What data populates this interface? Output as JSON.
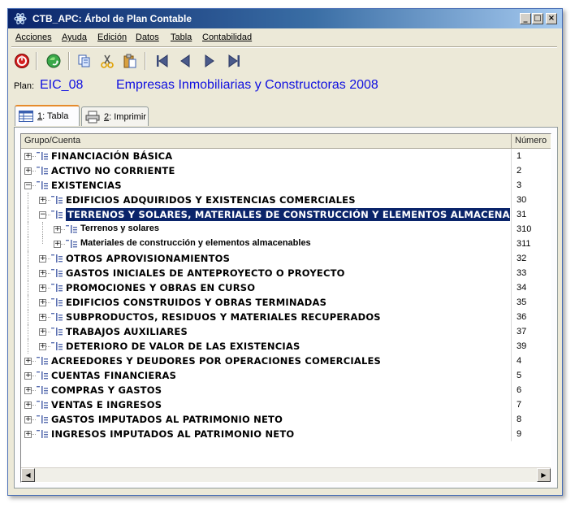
{
  "window": {
    "title": "CTB_APC: Árbol de Plan Contable"
  },
  "menu": [
    "Acciones",
    "Ayuda",
    "Edición",
    "Datos",
    "Tabla",
    "Contabilidad"
  ],
  "toolbar": {
    "icons": [
      "close-red-icon",
      "refresh-globe-icon",
      "copy-icon",
      "cut-icon",
      "paste-icon",
      "first-record-icon",
      "previous-record-icon",
      "next-record-icon",
      "last-record-icon"
    ]
  },
  "plan": {
    "label": "Plan:",
    "code": "EIC_08",
    "name": "Empresas Inmobiliarias y Constructoras 2008"
  },
  "tabs": [
    {
      "key": "1",
      "label": ": Tabla",
      "icon": "table-icon",
      "active": true
    },
    {
      "key": "2",
      "label": ": Imprimir",
      "icon": "printer-icon",
      "active": false
    }
  ],
  "grid": {
    "columns": {
      "group": "Grupo/Cuenta",
      "number": "Número"
    },
    "rows": [
      {
        "level": 1,
        "label": "FINANCIACIÓN BÁSICA",
        "number": "1",
        "expanded": false
      },
      {
        "level": 1,
        "label": "ACTIVO NO CORRIENTE",
        "number": "2",
        "expanded": false
      },
      {
        "level": 1,
        "label": "EXISTENCIAS",
        "number": "3",
        "expanded": true
      },
      {
        "level": 2,
        "label": "EDIFICIOS ADQUIRIDOS Y EXISTENCIAS COMERCIALES",
        "number": "30",
        "expanded": false
      },
      {
        "level": 2,
        "label": "TERRENOS Y SOLARES, MATERIALES DE CONSTRUCCIÓN Y ELEMENTOS ALMACENAB...",
        "number": "31",
        "expanded": true,
        "selected": true
      },
      {
        "level": 3,
        "label": "Terrenos y solares",
        "number": "310",
        "expanded": false
      },
      {
        "level": 3,
        "label": "Materiales de construcción y elementos almacenables",
        "number": "311",
        "expanded": false
      },
      {
        "level": 2,
        "label": "OTROS APROVISIONAMIENTOS",
        "number": "32",
        "expanded": false
      },
      {
        "level": 2,
        "label": "GASTOS INICIALES DE ANTEPROYECTO O PROYECTO",
        "number": "33",
        "expanded": false
      },
      {
        "level": 2,
        "label": "PROMOCIONES Y OBRAS EN CURSO",
        "number": "34",
        "expanded": false
      },
      {
        "level": 2,
        "label": "EDIFICIOS CONSTRUIDOS Y OBRAS TERMINADAS",
        "number": "35",
        "expanded": false
      },
      {
        "level": 2,
        "label": "SUBPRODUCTOS, RESIDUOS Y MATERIALES RECUPERADOS",
        "number": "36",
        "expanded": false
      },
      {
        "level": 2,
        "label": "TRABAJOS AUXILIARES",
        "number": "37",
        "expanded": false
      },
      {
        "level": 2,
        "label": "DETERIORO DE VALOR DE LAS EXISTENCIAS",
        "number": "39",
        "expanded": false
      },
      {
        "level": 1,
        "label": "ACREEDORES Y DEUDORES POR OPERACIONES COMERCIALES",
        "number": "4",
        "expanded": false
      },
      {
        "level": 1,
        "label": "CUENTAS FINANCIERAS",
        "number": "5",
        "expanded": false
      },
      {
        "level": 1,
        "label": "COMPRAS Y GASTOS",
        "number": "6",
        "expanded": false
      },
      {
        "level": 1,
        "label": "VENTAS E INGRESOS",
        "number": "7",
        "expanded": false
      },
      {
        "level": 1,
        "label": "GASTOS IMPUTADOS AL PATRIMONIO NETO",
        "number": "8",
        "expanded": false
      },
      {
        "level": 1,
        "label": "INGRESOS IMPUTADOS AL PATRIMONIO NETO",
        "number": "9",
        "expanded": false
      }
    ]
  }
}
